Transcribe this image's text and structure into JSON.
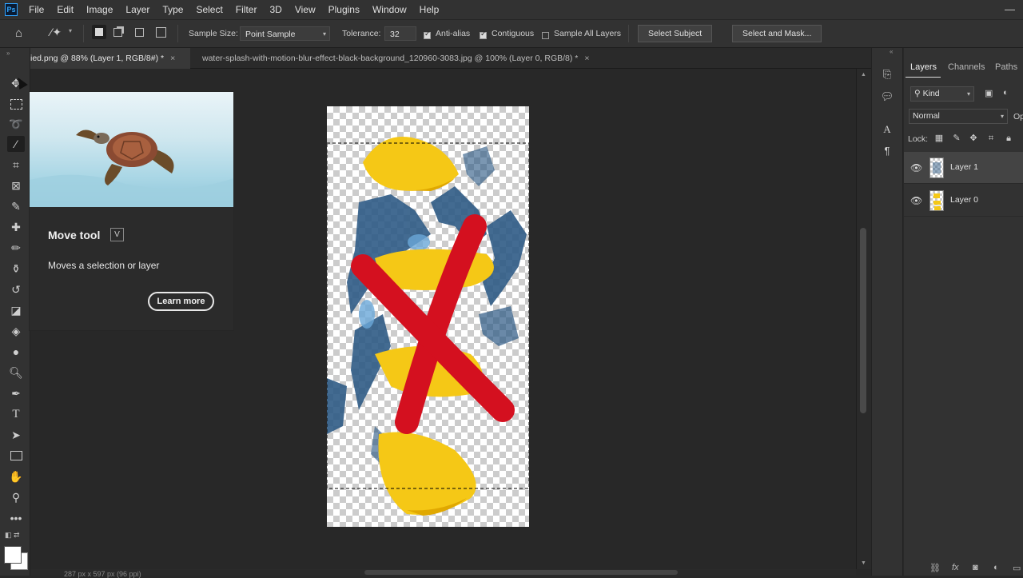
{
  "app": {
    "logo": "Ps"
  },
  "menu": [
    "File",
    "Edit",
    "Image",
    "Layer",
    "Type",
    "Select",
    "Filter",
    "3D",
    "View",
    "Plugins",
    "Window",
    "Help"
  ],
  "options": {
    "sample_size_label": "Sample Size:",
    "sample_size_value": "Point Sample",
    "tolerance_label": "Tolerance:",
    "tolerance_value": "32",
    "anti_alias_label": "Anti-alias",
    "contiguous_label": "Contiguous",
    "sample_all_layers_label": "Sample All Layers",
    "select_subject_label": "Select Subject",
    "select_and_mask_label": "Select and Mask..."
  },
  "tabs": [
    {
      "label": "ied.png @ 88% (Layer 1, RGB/8#) *",
      "close": "×"
    },
    {
      "label": "water-splash-with-motion-blur-effect-black-background_120960-3083.jpg @ 100% (Layer 0, RGB/8) *",
      "close": "×"
    }
  ],
  "tooltip": {
    "title": "Move tool",
    "shortcut": "V",
    "description": "Moves a selection or layer",
    "learn_more": "Learn more"
  },
  "status": "287 px x 597 px (96 ppi)",
  "layers_panel": {
    "tabs": [
      "Layers",
      "Channels",
      "Paths"
    ],
    "filter_label": "Kind",
    "blend_mode": "Normal",
    "opacity_abbrev": "Op",
    "lock_label": "Lock:",
    "layers": [
      {
        "name": "Layer 1",
        "selected": true
      },
      {
        "name": "Layer 0",
        "selected": false
      }
    ]
  },
  "colors": {
    "accent_red": "#d4101f",
    "lemon_yellow": "#f5c816",
    "splash_blue": "#2f5b86",
    "ui_dark": "#323232"
  }
}
